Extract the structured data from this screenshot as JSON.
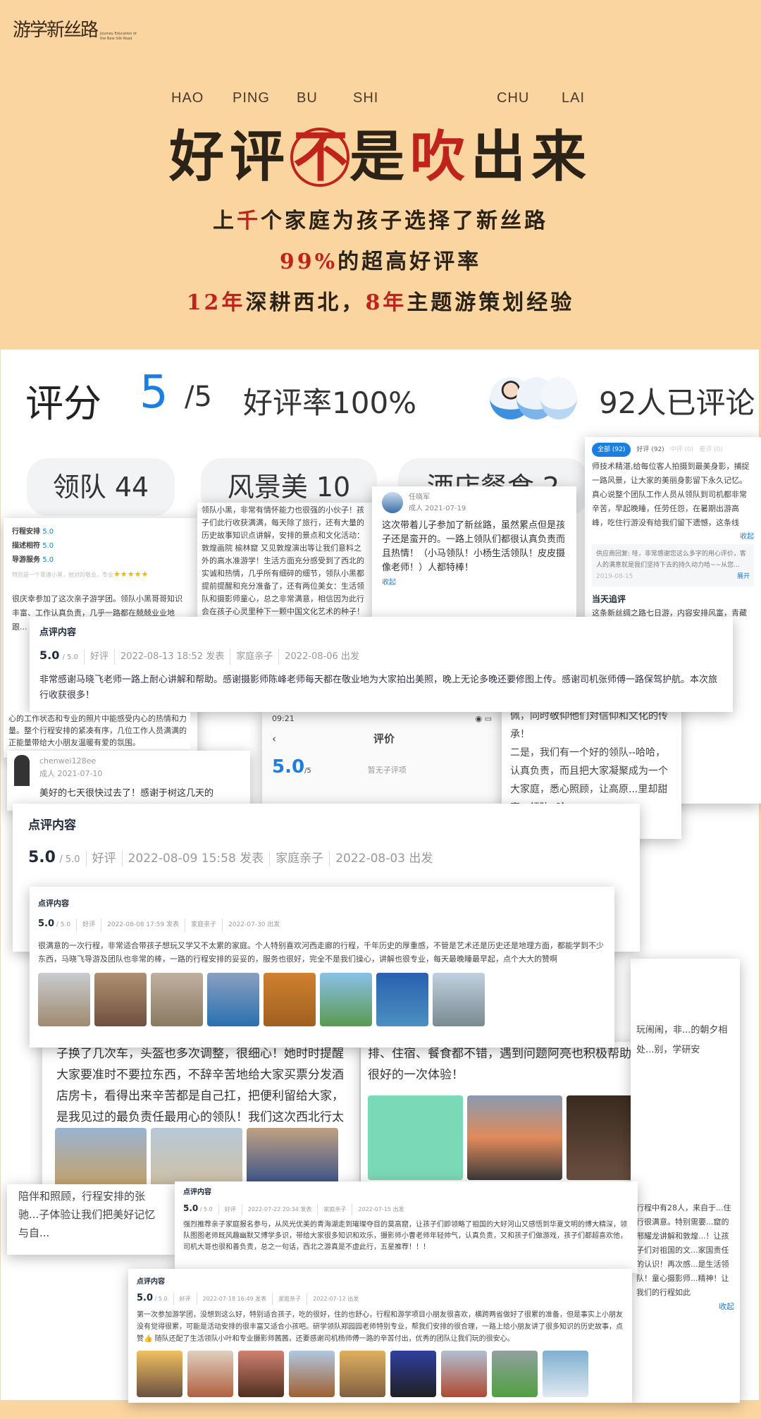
{
  "logo": {
    "zh": "游学新丝路",
    "en": "Journey Education of the New Silk Road"
  },
  "hero": {
    "pinyin": [
      "HAO",
      "PING",
      "BU",
      "SHI",
      "CHU",
      "LAI"
    ],
    "title": [
      "好",
      "评",
      "不",
      "是",
      "吹",
      "出",
      "来"
    ],
    "line1": {
      "a": "上",
      "b": "千",
      "c": "个家庭为孩子选择了新丝路"
    },
    "line2": {
      "a": "99%",
      "b": "的超高好评率"
    },
    "line3": {
      "a": "12年",
      "b": "深耕西北，",
      "c": "8年",
      "d": "主题游策划经验"
    }
  },
  "colors": {
    "accent_red": "#c0221c",
    "blue": "#1a7fe0",
    "bg": "#fbd59f"
  },
  "summary": {
    "score_label": "评分",
    "score": "5",
    "score_max": "/5",
    "rate": "好评率100%",
    "count": "92人已评论"
  },
  "tags": [
    "领队 44",
    "风景美 10",
    "酒店餐食 2"
  ],
  "right_panel": {
    "tabs": [
      "全部 (92)",
      "好评 (92)",
      "中评 (0)",
      "差评 (0)"
    ],
    "text": "师技术精湛,给每位客人拍摄到最美身影，捕捉一路风景，让大家的美丽身影留下永久记忆。真心说整个团队工作人员从领队到司机都非常辛苦，早起晚睡，任劳任怨，在暑期出游高峰，吃住行游没有给我们留下遗憾，这条线",
    "collapse": "收起",
    "reply": "供应商回复: 哇，非常感谢您这么多字的用心评价，客人的满意就是我们坚持下去的持久动力哈~~从您...",
    "reply_date": "2019-08-15",
    "expand": "展开",
    "followup_title": "当天追评",
    "followup": "这条新丝绸之路七日游，内容安排风富，青藏高原..."
  },
  "left_card": {
    "ratings": [
      {
        "k": "行程安排",
        "v": "5.0"
      },
      {
        "k": "描述相符",
        "v": "5.0"
      },
      {
        "k": "导游服务",
        "v": "5.0"
      }
    ],
    "note": "特别是一个靠谱小黑，他对的敬业，专业",
    "text": "很庆幸参加了这次亲子游学团。领队小黑哥哥知识丰富、工作认真负责，几乎一路都在兢兢业业地跟..."
  },
  "mid_card": {
    "text": "领队小黑，非常有情怀能力也很强的小伙子！孩子们此行收获满满，每天除了旅行，还有大量的历史故事知识点讲解，安排的景点和文化活动：敦煌画院 榆林窟 又见敦煌演出等让我们意料之外的高水准游学！生活方面充分感受到了西北的实诚和热情，几乎所有细碎的细节，领队小黑都提前提醒和充分准备了，还有两位美女：生活领队和摄影师童心，总之非常满意，相信因为此行会在孩子心灵里种下一颗中国文化艺术的种子！持续关注你们的其他产品！"
  },
  "user_card": {
    "name": "任晓军",
    "sub": "成人 2021-07-19",
    "text": "这次带着儿子参加了新丝路，虽然累点但是孩子还是蛮开的。一路上领队们都很认真负责而且热情！（小马领队！小杨生活领队！皮皮摄像老师！）人都特棒！",
    "collapse": "收起"
  },
  "reviews": [
    {
      "header": "点评内容",
      "score": "5.0",
      "max": "/ 5.0",
      "type": "好评",
      "posted": "2022-08-13 18:52 发表",
      "group": "家庭亲子",
      "depart": "2022-08-06 出发",
      "text": "非常感谢马晓飞老师一路上耐心讲解和帮助。感谢摄影师陈峰老师每天都在敬业地为大家拍出美照，晚上无论多晚还要修图上传。感谢司机张师傅一路保驾护航。本次旅行收获很多！"
    },
    {
      "header": "点评内容",
      "score": "5.0",
      "max": "/ 5.0",
      "type": "好评",
      "posted": "2022-08-09 15:58 发表",
      "group": "家庭亲子",
      "depart": "2022-08-03 出发",
      "text": ""
    },
    {
      "header": "点评内容",
      "score": "5.0",
      "max": "/ 5.0",
      "type": "好评",
      "posted": "2022-08-08 17:59 发表",
      "group": "家庭亲子",
      "depart": "2022-07-30 出发",
      "text": "很满意的一次行程，非常适合带孩子想玩又学又不太累的家庭。个人特别喜欢河西走廊的行程，千年历史的厚重感，不管是艺术还是历史还是地理方面，都能学到不少东西，马晓飞导游及团队也非常的棒，一路的行程安排的妥妥的，服务也很好，完全不是我们操心，讲解也很专业，每天最晚睡最早起，点个大大的赞啊"
    },
    {
      "header": "点评内容",
      "score": "5.0",
      "max": "/ 5.0",
      "type": "好评",
      "posted": "2022-07-22 20:34 发表",
      "group": "家庭亲子",
      "depart": "2022-07-15 出发",
      "text": "强烈推荐亲子家庭报名参与，从风光优美的青海湖走到璀璨夺目的莫高窟，让孩子们即领略了祖国的大好河山又感悟到华夏文明的博大精深，领队图图老师既风趣幽默又博学多识，带给大家很多知识和欢乐，摄影师小曹老师年轻帅气，认真负责，又和孩子们做游戏，孩子们都超喜欢他，司机大哥也很和善负责，总之一句话，西北之游真是不虚此行，五星推荐！！！"
    },
    {
      "header": "点评内容",
      "score": "5.0",
      "max": "/ 5.0",
      "type": "好评",
      "posted": "2022-07-18 16:49 发表",
      "group": "家庭亲子",
      "depart": "2022-07-12 出发",
      "text": "第一次参加游学团，没想到这么好，特别适合孩子，吃的很好，住的也舒心，行程和游学项目小朋友很喜欢，横跨两省做好了很累的准备，但是事实上小朋友没有觉得很累，可能是活动安排的很丰富又适合小孩吧。研学领队郑园园老师特别专业，帮我们安排的很合理，一路上给小朋友讲了很多知识的历史故事，点赞👍 随队还配了生活领队小叶和专业摄影师茜茜，还要感谢司机杨师傅一路的辛苦付出，优秀的团队让我们玩的很安心。"
    }
  ],
  "phone": {
    "time": "09:21",
    "title": "评价",
    "score": "5.0",
    "max": "/5",
    "note": "暂无子评项"
  },
  "chen_card": {
    "name": "chenwei128ee",
    "sub": "成人 2021-07-10",
    "text": "美好的七天很快过去了！感谢于树这几天的"
  },
  "right_text": {
    "text": "佩，同时敬仰他们对信仰和文化的传承！\n二是，我们有一个好的领队--哈哈，认真负责，而且把大家凝聚成为一个大家庭，悉心照顾，让高原...里却甜蜜...领队--哈"
  },
  "left_bg_text": "心的工作状态和专业的照片中能感受内心的热情和力量。整个行程安排的紧凑有序，几位工作人员满满的正能量带给大小朋友温暖有爱的氛围。",
  "lower_left": {
    "text": "子换了几次车，头盔也多次调整，很细心！她时时提醒大家要准时不要拉东西，不辞辛苦地给大家买票分发酒店房卡，看得出来辛苦都是自己扛，把便利留给大家，是我见过的最负责任最用心的领队！我们这次西北行太赞了！",
    "tail": "陪伴和照顾，行程安排的张驰...子体验让我们把美好记忆与自..."
  },
  "lower_mid": {
    "text": "排、住宿、餐食都不错，遇到问题阿亮也积极帮助解决，很好的一次体验！",
    "partial": "玩闹闹，非...的朝夕相处...别，学研安"
  },
  "lower_right": {
    "text": "行程中有28人，来自于...住行很满意。特别需要...窟的邢耀龙讲解和敦煌...！让孩子们对祖国的文...家国责任的认识！再次感...是生活领队！童心摄影师...精神！让我们的行程如此",
    "collapse": "收起"
  }
}
